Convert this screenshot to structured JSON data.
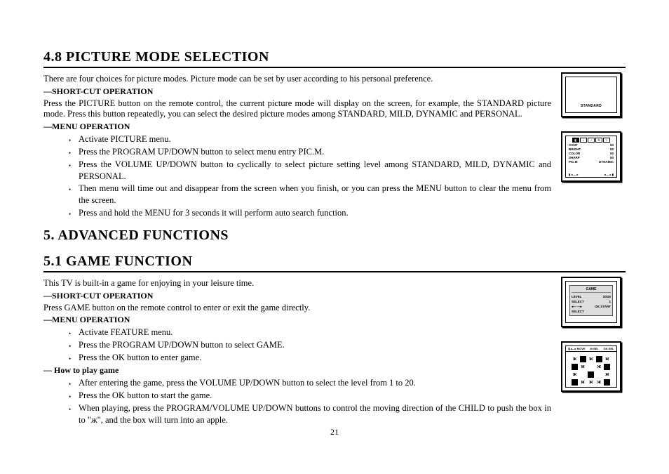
{
  "page_number": "21",
  "sections": {
    "s48": {
      "heading": "4.8 PICTURE MODE SELECTION",
      "intro": "There are four choices for picture modes. Picture mode can be set by user according to his personal preference.",
      "shortcut_label": "—SHORT-CUT OPERATION",
      "shortcut_text": "Press the PICTURE button on the remote control, the current picture mode will display on the screen, for example, the STANDARD picture mode. Press this button repeatedly, you can select the desired picture modes among STANDARD, MILD, DYNAMIC and PERSONAL.",
      "menu_label": "—MENU OPERATION",
      "menu_items": {
        "0": "Activate PICTURE menu.",
        "1": "Press the PROGRAM UP/DOWN button to select menu entry PIC.M.",
        "2": "Press the VOLUME UP/DOWN button to cyclically to select picture setting level among STANDARD, MILD, DYNAMIC and PERSONAL.",
        "3": "Then menu will time out and disappear from the screen when you finish, or you can press the MENU button to clear the menu from the screen.",
        "4": "Press and hold the MENU for 3 seconds it will perform auto search function."
      }
    },
    "s5": {
      "heading": "5.   ADVANCED FUNCTIONS"
    },
    "s51": {
      "heading": "5.1 GAME FUNCTION",
      "intro": "This TV is built-in a game for enjoying in your leisure time.",
      "shortcut_label": "—SHORT-CUT OPERATION",
      "shortcut_text": "Press GAME button on the remote control to enter or exit the game directly.",
      "menu_label": "—MENU OPERATION",
      "menu_items": {
        "0": "Activate FEATURE menu.",
        "1": "Press the PROGRAM UP/DOWN button to select GAME.",
        "2": "Press the OK button to enter game."
      },
      "howto_label": "— How to play game",
      "howto_items": {
        "0": "After entering the game, press the VOLUME UP/DOWN button to select the level from 1 to 20.",
        "1": "Press the OK button to start the game.",
        "2": "When playing, press the PROGRAM/VOLUME UP/DOWN buttons to control the moving direction of the CHILD to push the box in to \"ж\", and the box will turn into an apple."
      }
    }
  },
  "osd": {
    "fig1_label": "STANDARD",
    "picture_menu": {
      "rows": {
        "0": {
          "k": "CONT",
          "v": "50"
        },
        "1": {
          "k": "BRIGHT",
          "v": "50"
        },
        "2": {
          "k": "COLOR",
          "v": "50"
        },
        "3": {
          "k": "SHARP",
          "v": "50"
        },
        "4": {
          "k": "PIC.M",
          "v": "DYNAMIC"
        }
      },
      "foot_l": "▮ ◂ — ▸",
      "foot_r": "◂ — ▸ ▮"
    },
    "game_menu": {
      "title": "GAME",
      "rows": {
        "0": {
          "k": "LEVEL",
          "v": "20/20"
        },
        "1": {
          "k": "SELECT",
          "v": "1"
        },
        "2": {
          "k": "◂— —▸ SELECT",
          "v": "OK:START"
        }
      }
    },
    "game_play": {
      "top": {
        "0": "▮ ◂—▸ MOVE",
        "1": "M:SEL",
        "2": "OK:SEL"
      }
    }
  }
}
